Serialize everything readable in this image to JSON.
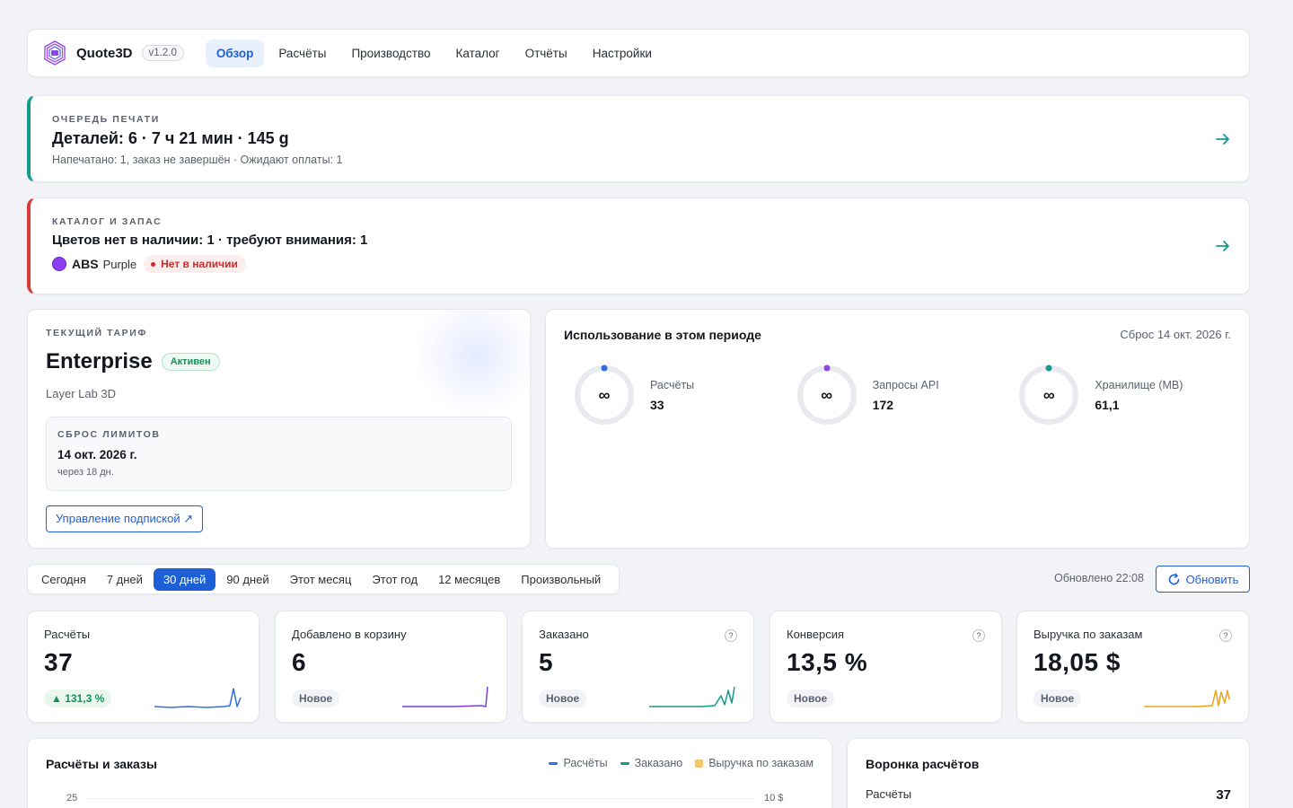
{
  "app": {
    "name": "Quote3D",
    "version": "v1.2.0"
  },
  "nav": {
    "items": [
      "Обзор",
      "Расчёты",
      "Производство",
      "Каталог",
      "Отчёты",
      "Настройки"
    ],
    "active": "Обзор"
  },
  "queue": {
    "overline": "Очередь печати",
    "headline": "Деталей: 6 · 7 ч 21 мин · 145 g",
    "sub": "Напечатано: 1, заказ не завершён · Ожидают оплаты: 1",
    "accent": "#159a8c"
  },
  "catalog": {
    "overline": "Каталог и запас",
    "headline": "Цветов нет в наличии: 1 · требуют внимания: 1",
    "filament": {
      "type": "ABS",
      "color": "Purple",
      "swatch": "#8b3ff0",
      "status": "Нет в наличии"
    },
    "accent": "#d93b3b"
  },
  "plan": {
    "overline": "Текущий тариф",
    "name": "Enterprise",
    "status": "Активен",
    "org": "Layer Lab 3D",
    "reset_overline": "Сброс лимитов",
    "reset_date": "14 окт. 2026 г.",
    "reset_in": "через 18 дн.",
    "manage_label": "Управление подпиской ↗"
  },
  "usage": {
    "title": "Использование в этом периоде",
    "reset": "Сброс 14 окт. 2026 г.",
    "items": [
      {
        "name": "Расчёты",
        "value": "33",
        "limit": "∞",
        "color": "#2f6fe0"
      },
      {
        "name": "Запросы API",
        "value": "172",
        "limit": "∞",
        "color": "#8a45e8"
      },
      {
        "name": "Хранилище (MB)",
        "value": "61,1",
        "limit": "∞",
        "color": "#159a8c"
      }
    ]
  },
  "range": {
    "options": [
      "Сегодня",
      "7 дней",
      "30 дней",
      "90 дней",
      "Этот месяц",
      "Этот год",
      "12 месяцев",
      "Произвольный"
    ],
    "active": "30 дней",
    "updated": "Обновлено 22:08",
    "refresh_label": "Обновить"
  },
  "kpis": [
    {
      "label": "Расчёты",
      "value": "37",
      "badge": "▲ 131,3 %",
      "badge_type": "up",
      "help": false,
      "color": "#2f6fe0"
    },
    {
      "label": "Добавлено в корзину",
      "value": "6",
      "badge": "Новое",
      "badge_type": "new",
      "help": false,
      "color": "#7a3fe0"
    },
    {
      "label": "Заказано",
      "value": "5",
      "badge": "Новое",
      "badge_type": "new",
      "help": true,
      "color": "#159a8c"
    },
    {
      "label": "Конверсия",
      "value": "13,5 %",
      "badge": "Новое",
      "badge_type": "new",
      "help": true,
      "color": "#2f6fe0"
    },
    {
      "label": "Выручка по заказам",
      "value": "18,05 $",
      "badge": "Новое",
      "badge_type": "new",
      "help": true,
      "color": "#eea320"
    }
  ],
  "orders_chart": {
    "title": "Расчёты и заказы",
    "legend": [
      {
        "name": "Расчёты",
        "color": "#2f6fe0",
        "kind": "line"
      },
      {
        "name": "Заказано",
        "color": "#159a8c",
        "kind": "line"
      },
      {
        "name": "Выручка по заказам",
        "color": "#f2c66d",
        "kind": "dot"
      }
    ],
    "y_left_top": "25",
    "y_right_top": "10 $"
  },
  "funnel": {
    "title": "Воронка расчётов",
    "rows": [
      {
        "label": "Расчёты",
        "value": "37"
      }
    ]
  }
}
